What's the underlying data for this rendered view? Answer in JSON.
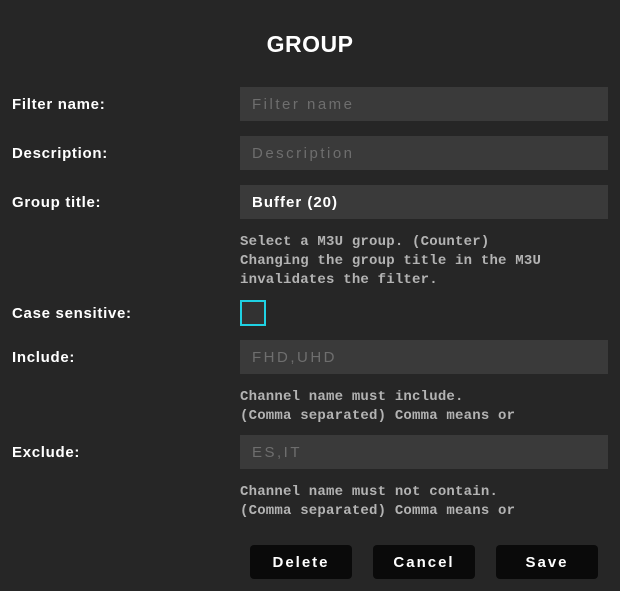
{
  "title": "GROUP",
  "form": {
    "filter_name": {
      "label": "Filter name:",
      "placeholder": "Filter name",
      "value": ""
    },
    "description": {
      "label": "Description:",
      "placeholder": "Description",
      "value": ""
    },
    "group_title": {
      "label": "Group title:",
      "selected_value": "Buffer (20)",
      "help": [
        "Select a M3U group. (Counter)",
        "Changing the group title in the M3U",
        "invalidates the filter."
      ]
    },
    "case_sensitive": {
      "label": "Case sensitive:",
      "checked": false
    },
    "include": {
      "label": "Include:",
      "placeholder": "FHD,UHD",
      "value": "",
      "help": [
        "Channel name must include.",
        "(Comma separated) Comma means or"
      ]
    },
    "exclude": {
      "label": "Exclude:",
      "placeholder": "ES,IT",
      "value": "",
      "help": [
        "Channel name must not contain.",
        "(Comma separated) Comma means or"
      ]
    }
  },
  "buttons": {
    "delete": "Delete",
    "cancel": "Cancel",
    "save": "Save"
  },
  "colors": {
    "background": "#262626",
    "input_background": "#3a3a3a",
    "placeholder_text": "#6e6e6e",
    "help_text": "#b3b3b3",
    "checkbox_border": "#1fd1e3",
    "button_background": "#0a0a0a",
    "text": "#ffffff"
  }
}
